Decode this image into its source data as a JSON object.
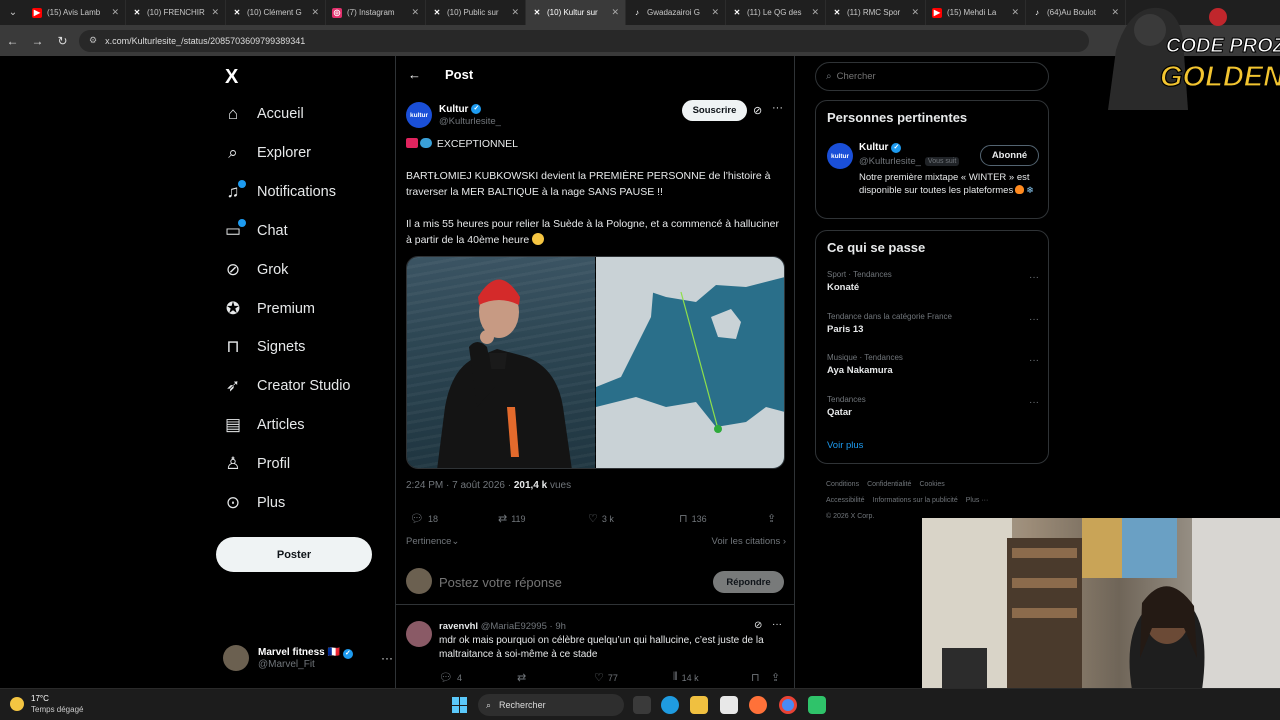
{
  "browser": {
    "tabs": [
      {
        "label": "(15) Avis Lamb",
        "icon": "youtube-icon",
        "color": "#ff0000"
      },
      {
        "label": "(10) FRENCHIR",
        "icon": "x-logo-icon",
        "color": "#ffffff"
      },
      {
        "label": "(10) Clément G",
        "icon": "x-logo-icon",
        "color": "#ffffff"
      },
      {
        "label": "(7) Instagram",
        "icon": "instagram-icon",
        "color": "#e1306c"
      },
      {
        "label": "(10) Public sur",
        "icon": "x-logo-icon",
        "color": "#ffffff"
      },
      {
        "label": "(10) Kultur sur",
        "icon": "x-logo-icon",
        "color": "#ffffff",
        "active": true
      },
      {
        "label": "Gwadazairoi G",
        "icon": "tiktok-icon",
        "color": "#ffffff"
      },
      {
        "label": "(11) Le QG des",
        "icon": "x-logo-icon",
        "color": "#ffffff"
      },
      {
        "label": "(11) RMC Spor",
        "icon": "x-logo-icon",
        "color": "#ffffff"
      },
      {
        "label": "(15) Mehdi La",
        "icon": "youtube-icon",
        "color": "#ff0000"
      },
      {
        "label": "(64)Au Boulot",
        "icon": "tiktok-icon",
        "color": "#ffffff"
      }
    ],
    "url": "x.com/Kulturlesite_/status/2085703609799389341"
  },
  "nav": {
    "logo": "X",
    "items": [
      {
        "label": "Accueil",
        "icon": "home-icon"
      },
      {
        "label": "Explorer",
        "icon": "search-icon"
      },
      {
        "label": "Notifications",
        "icon": "bell-icon",
        "dot": true
      },
      {
        "label": "Chat",
        "icon": "chat-icon",
        "dot": true
      },
      {
        "label": "Grok",
        "icon": "grok-icon"
      },
      {
        "label": "Premium",
        "icon": "premium-icon"
      },
      {
        "label": "Signets",
        "icon": "bookmark-icon"
      },
      {
        "label": "Creator Studio",
        "icon": "rocket-icon"
      },
      {
        "label": "Articles",
        "icon": "article-icon"
      },
      {
        "label": "Profil",
        "icon": "person-icon"
      },
      {
        "label": "Plus",
        "icon": "more-circle-icon"
      }
    ],
    "post_button": "Poster",
    "account": {
      "name": "Marvel fitness 🇫🇷",
      "handle": "@Marvel_Fit"
    }
  },
  "main": {
    "header_title": "Post",
    "author": {
      "name": "Kultur",
      "handle": "@Kulturlesite_",
      "avatar_text": "kultur"
    },
    "subscribe_label": "Souscrire",
    "tweet": {
      "line1": "EXCEPTIONNEL",
      "para1": "BARTŁOMIEJ KUBKOWSKI devient la PREMIÈRE PERSONNE de l’histoire à traverser la MER BALTIQUE à la nage SANS PAUSE !!",
      "para2": "Il a mis 55 heures pour relier la Suède à la Pologne, et a commencé à halluciner à partir de la 40ème heure"
    },
    "meta": {
      "time": "2:24 PM · 7 août 2026 · ",
      "views": "201,4 k",
      "views_label": " vues"
    },
    "actions": {
      "replies": "18",
      "reposts": "119",
      "likes": "3 k",
      "bookmarks": "136"
    },
    "sort_label": "Pertinence",
    "quotes_label": "Voir les citations ›",
    "reply_placeholder": "Postez votre réponse",
    "reply_button": "Répondre",
    "reply": {
      "name": "ravenvhl",
      "handle": "@MariaE92995",
      "time": "· 9h",
      "text": "mdr ok mais pourquoi on célèbre quelqu’un qui hallucine, c’est juste de la maltraitance à soi-même à ce stade",
      "replies": "4",
      "likes": "77",
      "views": "14 k"
    }
  },
  "right": {
    "search_placeholder": "Chercher",
    "people": {
      "title": "Personnes pertinentes",
      "name": "Kultur",
      "handle": "@Kulturlesite_",
      "follows_you": "Vous suit",
      "follow_state": "Abonné",
      "bio": "Notre première mixtape « WINTER » est disponible sur toutes les plateformes"
    },
    "trends": {
      "title": "Ce qui se passe",
      "items": [
        {
          "category": "Sport · Tendances",
          "name": "Konaté"
        },
        {
          "category": "Tendance dans la catégorie France",
          "name": "Paris 13"
        },
        {
          "category": "Musique · Tendances",
          "name": "Aya Nakamura"
        },
        {
          "category": "Tendances",
          "name": "Qatar"
        }
      ],
      "show_more": "Voir plus"
    },
    "footer": [
      "Conditions",
      "Confidentialité",
      "Cookies",
      "Accessibilité",
      "Informations sur la publicité",
      "Plus ···",
      "© 2026 X Corp."
    ]
  },
  "overlay": {
    "line1": "CODE PROZIS",
    "line2": "GOLDENG"
  },
  "taskbar": {
    "temp": "17°C",
    "condition": "Temps dégagé",
    "search_label": "Rechercher"
  }
}
